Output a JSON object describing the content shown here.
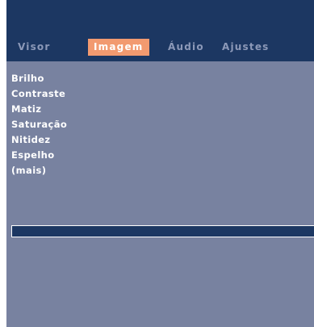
{
  "tabs": [
    {
      "label": "Visor",
      "active": false
    },
    {
      "label": "Imagem",
      "active": true
    },
    {
      "label": "Áudio",
      "active": false
    },
    {
      "label": "Ajustes",
      "active": false
    }
  ],
  "menu": {
    "items": [
      {
        "label": "Brilho"
      },
      {
        "label": "Contraste"
      },
      {
        "label": "Matiz"
      },
      {
        "label": "Saturação"
      },
      {
        "label": "Nitidez"
      },
      {
        "label": "Espelho"
      },
      {
        "label": "(mais)"
      }
    ]
  },
  "colors": {
    "header_bg": "#1c3762",
    "body_bg": "#7882a0",
    "active_tab_bg": "#f29a70",
    "inactive_tab_text": "#8c99b8",
    "text": "#ffffff"
  }
}
